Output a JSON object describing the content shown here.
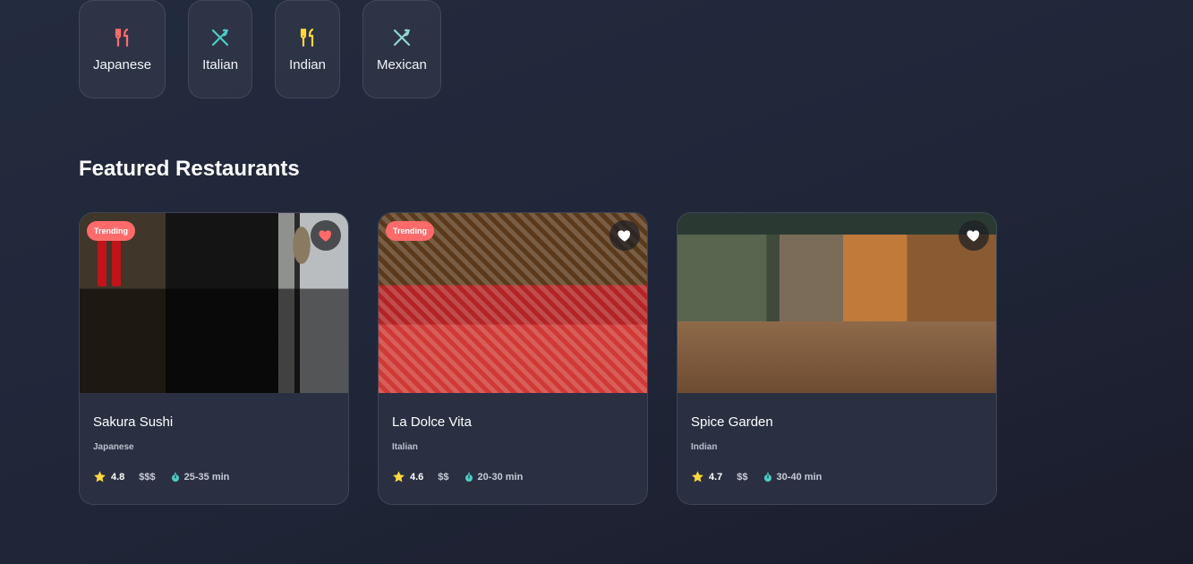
{
  "categories": [
    {
      "label": "Japanese",
      "icon": "fork-knife-icon",
      "color": "#ff6b6b"
    },
    {
      "label": "Italian",
      "icon": "utensils-crossed-icon",
      "color": "#4ecdc4"
    },
    {
      "label": "Indian",
      "icon": "fork-knife-icon",
      "color": "#ffd93d"
    },
    {
      "label": "Mexican",
      "icon": "utensils-crossed-icon",
      "color": "#8fd6d0"
    }
  ],
  "section_title": "Featured Restaurants",
  "restaurants": [
    {
      "name": "Sakura Sushi",
      "cuisine": "Japanese",
      "rating": "4.8",
      "price": "$$$",
      "time": "25-35 min",
      "badge": "Trending",
      "favorited": true
    },
    {
      "name": "La Dolce Vita",
      "cuisine": "Italian",
      "rating": "4.6",
      "price": "$$",
      "time": "20-30 min",
      "badge": "Trending",
      "favorited": false
    },
    {
      "name": "Spice Garden",
      "cuisine": "Indian",
      "rating": "4.7",
      "price": "$$",
      "time": "30-40 min",
      "badge": "",
      "favorited": false
    }
  ],
  "colors": {
    "accent": "#ff6b6b",
    "star": "#ffd93d",
    "timer": "#4ecdc4"
  }
}
